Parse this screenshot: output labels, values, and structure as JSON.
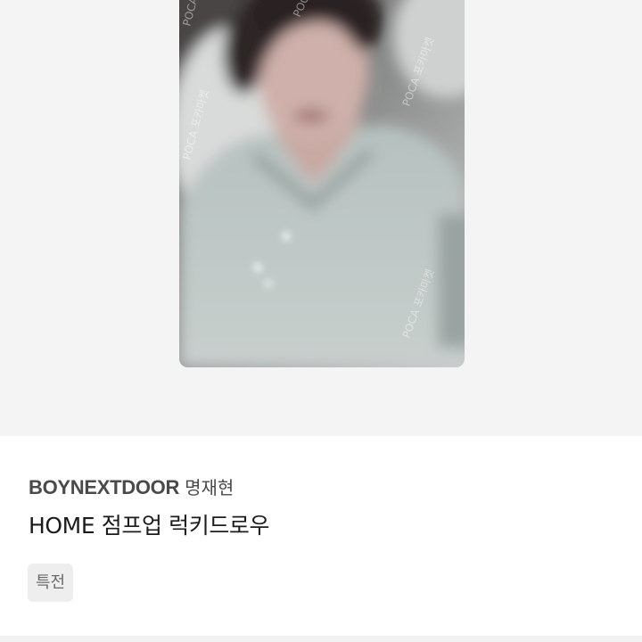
{
  "product": {
    "group": "BOYNEXTDOOR",
    "member": "명재현",
    "title": "HOME 점프업 럭키드로우",
    "tag": "특전"
  },
  "image": {
    "watermark": "POCA 포카마켓",
    "description_icon": "photocard-image"
  },
  "colors": {
    "image_bg": "#f4f4f4",
    "card_bg": "#c3cac8",
    "group_text": "#4a4a4a",
    "title_text": "#1c1c1c",
    "tag_bg": "#eeeeee",
    "tag_text": "#6a6a6a"
  }
}
